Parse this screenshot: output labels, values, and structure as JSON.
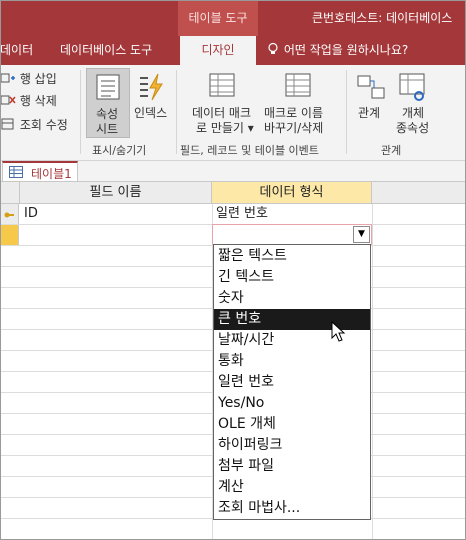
{
  "title_bar": {
    "context_tab": "테이블 도구",
    "window_title": "큰번호테스트: 데이터베이스"
  },
  "ribbon_tabs": [
    {
      "label": "데이터"
    },
    {
      "label": "데이터베이스 도구"
    },
    {
      "label": "디자인"
    }
  ],
  "tell_me": "어떤 작업을 원하시나요?",
  "ribbon": {
    "insert_row": "행 삽입",
    "delete_row": "행 삭제",
    "modify_lookup": "조회 수정",
    "property_sheet": [
      "속성",
      "시트"
    ],
    "indexes": "인덱스",
    "data_macro": [
      "데이터 매크",
      "로 만들기"
    ],
    "rename_macro": [
      "매크로 이름",
      "바꾸기/삭제"
    ],
    "relationships": "관계",
    "object_dependencies": [
      "개체",
      "종속성"
    ],
    "group_show_hide": "표시/숨기기",
    "group_events": "필드, 레코드 및 테이블 이벤트",
    "group_relationships": "관계"
  },
  "doc_tab": {
    "label": "테이블1"
  },
  "grid": {
    "col_field_name": "필드 이름",
    "col_data_type": "데이터 형식",
    "row1_field": "ID",
    "row1_type": "일련 번호"
  },
  "dropdown": {
    "options": [
      "짧은 텍스트",
      "긴 텍스트",
      "숫자",
      "큰 번호",
      "날짜/시간",
      "통화",
      "일련 번호",
      "Yes/No",
      "OLE 개체",
      "하이퍼링크",
      "첨부 파일",
      "계산",
      "조회 마법사..."
    ],
    "highlighted": "큰 번호"
  },
  "colors": {
    "brand": "#a4373a",
    "context": "#c0504d",
    "selected_option": "#1a1a1a"
  }
}
